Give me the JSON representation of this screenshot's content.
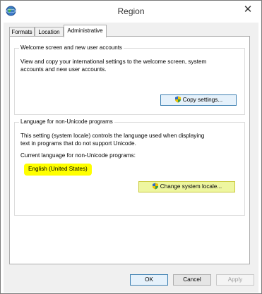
{
  "window": {
    "title": "Region",
    "close_glyph": "✕"
  },
  "tabs": [
    {
      "label": "Formats",
      "active": false
    },
    {
      "label": "Location",
      "active": false
    },
    {
      "label": "Administrative",
      "active": true
    }
  ],
  "welcome_group": {
    "title": "Welcome screen and new user accounts",
    "description_line1": "View and copy your international settings to the welcome screen, system",
    "description_line2": "accounts and new user accounts.",
    "button_label": "Copy settings..."
  },
  "unicode_group": {
    "title": "Language for non-Unicode programs",
    "description_line1": "This setting (system locale) controls the language used when displaying",
    "description_line2": "text in programs that do not support Unicode.",
    "current_label": "Current language for non-Unicode programs:",
    "current_value": "English (United States)",
    "button_label": "Change system locale..."
  },
  "footer": {
    "ok_label": "OK",
    "cancel_label": "Cancel",
    "apply_label": "Apply"
  },
  "colors": {
    "highlight": "#ffff00",
    "shield_blue": "#2d6bc4",
    "shield_yellow": "#f2c200",
    "shield_green": "#3a9a3a"
  },
  "icons": {
    "app": "globe-icon",
    "button_shield": "uac-shield-icon",
    "close": "close-icon"
  }
}
